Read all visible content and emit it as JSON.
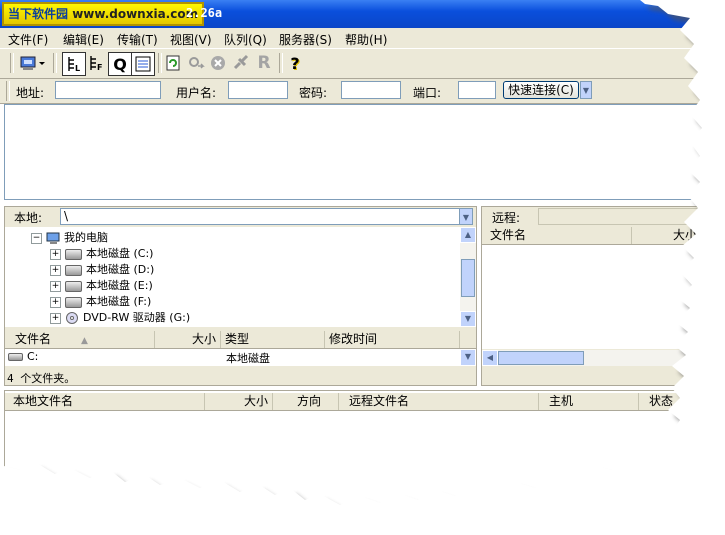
{
  "window": {
    "logo_text": "当下软件园",
    "logo_site": "www.downxia.com",
    "version": "2.26a"
  },
  "menu": [
    "文件(F)",
    "编辑(E)",
    "传输(T)",
    "视图(V)",
    "队列(Q)",
    "服务器(S)",
    "帮助(H)"
  ],
  "quickconnect": {
    "host_label": "地址:",
    "host_value": "",
    "user_label": "用户名:",
    "user_value": "",
    "pass_label": "密码:",
    "pass_value": "",
    "port_label": "端口:",
    "port_value": "",
    "button": "快速连接(C)"
  },
  "local": {
    "label": "本地:",
    "path": "\\",
    "tree": [
      {
        "label": "我的电脑",
        "icon": "computer-icon"
      },
      {
        "label": "本地磁盘 (C:)",
        "icon": "hard-disk-icon"
      },
      {
        "label": "本地磁盘 (D:)",
        "icon": "hard-disk-icon"
      },
      {
        "label": "本地磁盘 (E:)",
        "icon": "hard-disk-icon"
      },
      {
        "label": "本地磁盘 (F:)",
        "icon": "hard-disk-icon"
      },
      {
        "label": "DVD-RW 驱动器 (G:)",
        "icon": "dvd-drive-icon"
      }
    ],
    "columns": [
      "文件名",
      "大小",
      "类型",
      "修改时间"
    ],
    "files": [
      {
        "name": "C:",
        "size": "",
        "type": "本地磁盘",
        "modified": ""
      }
    ],
    "status": "4 个文件夹。"
  },
  "remote": {
    "label": "远程:",
    "path": "",
    "columns": [
      "文件名",
      "大小"
    ]
  },
  "queue": {
    "columns": [
      "本地文件名",
      "大小",
      "方向",
      "远程文件名",
      "主机",
      "状态"
    ]
  },
  "colors": {
    "titlebar": "#0a4fdc",
    "logo_bg": "#fff700",
    "chrome": "#ece9d8",
    "accent": "#c1d3fb"
  }
}
